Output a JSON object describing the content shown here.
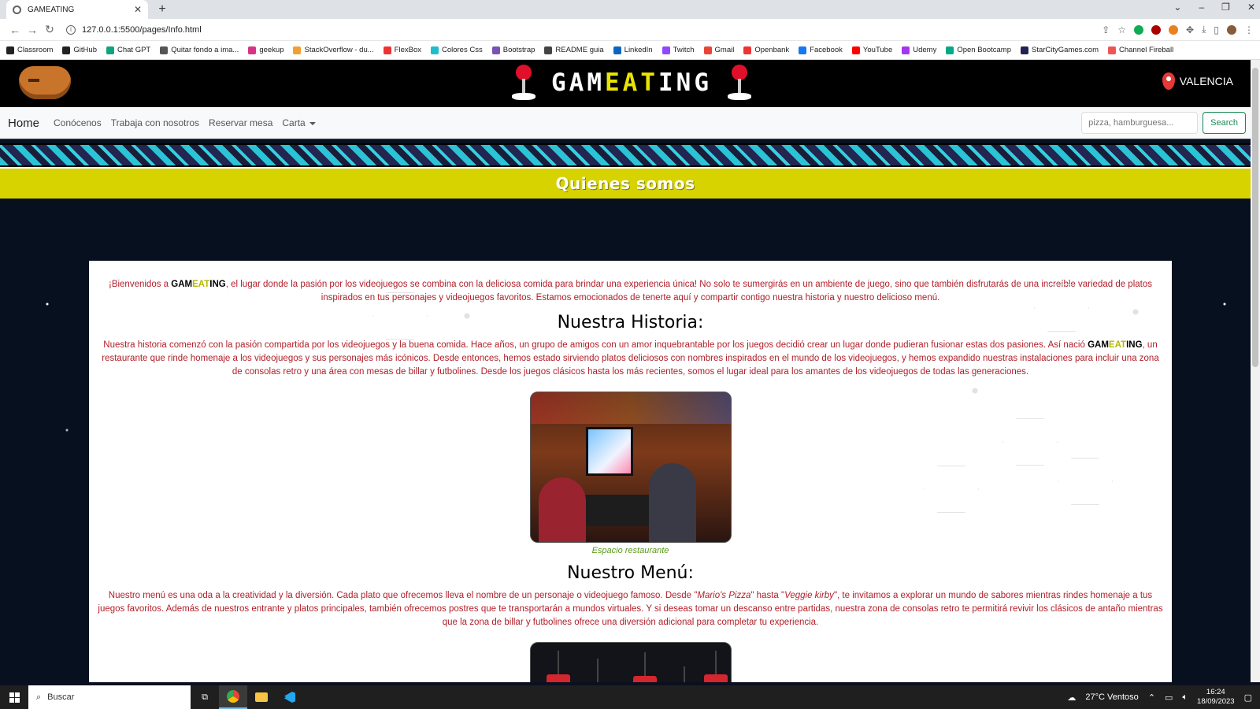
{
  "browser": {
    "tab_title": "GAMEATING",
    "tab_close": "✕",
    "new_tab": "+",
    "url": "127.0.0.1:5500/pages/Info.html",
    "bookmarks": [
      "Classroom",
      "GitHub",
      "Chat GPT",
      "Quitar fondo a ima...",
      "geekup",
      "StackOverflow - du...",
      "FlexBox",
      "Colores Css",
      "Bootstrap",
      "README guia",
      "LinkedIn",
      "Twitch",
      "Gmail",
      "Openbank",
      "Facebook",
      "YouTube",
      "Udemy",
      "Open Bootcamp",
      "StarCityGames.com",
      "Channel Fireball"
    ],
    "bookmark_colors": [
      "#222",
      "#222",
      "#10a37f",
      "#555",
      "#d63384",
      "#f0a030",
      "#e33",
      "#2bc",
      "#7952b3",
      "#444",
      "#0a66c2",
      "#9146ff",
      "#ea4335",
      "#e33",
      "#1877f2",
      "#f00",
      "#a435f0",
      "#0a8",
      "#225",
      "#e55"
    ]
  },
  "header": {
    "brand_left": "GAM",
    "brand_mid": "EAT",
    "brand_right": "ING",
    "location": "VALENCIA"
  },
  "nav": {
    "home": "Home",
    "links": [
      "Conócenos",
      "Trabaja con nosotros",
      "Reservar mesa"
    ],
    "dropdown": "Carta",
    "search_placeholder": "pizza, hamburguesa...",
    "search_button": "Search"
  },
  "section_title": "Quienes somos",
  "intro": {
    "before": "¡Bienvenidos a ",
    "after": ", el lugar donde la pasión por los videojuegos se combina con la deliciosa comida para brindar una experiencia única! No solo te sumergirás en un ambiente de juego, sino que también disfrutarás de una increíble variedad de platos inspirados en tus personajes y videojuegos favoritos. Estamos emocionados de tenerte aquí y compartir contigo nuestra historia y nuestro delicioso menú."
  },
  "historia": {
    "title": "Nuestra Historia:",
    "before": "Nuestra historia comenzó con la pasión compartida por los videojuegos y la buena comida. Hace años, un grupo de amigos con un amor inquebrantable por los juegos decidió crear un lugar donde pudieran fusionar estas dos pasiones. Así nació ",
    "after": ", un restaurante que rinde homenaje a los videojuegos y sus personajes más icónicos. Desde entonces, hemos estado sirviendo platos deliciosos con nombres inspirados en el mundo de los videojuegos, y hemos expandido nuestras instalaciones para incluir una zona de consolas retro y una área con mesas de billar y futbolines. Desde los juegos clásicos hasta los más recientes, somos el lugar ideal para los amantes de los videojuegos de todas las generaciones.",
    "caption": "Espacio restaurante"
  },
  "menu": {
    "title": "Nuestro Menú:",
    "p1": "Nuestro menú es una oda a la creatividad y la diversión. Cada plato que ofrecemos lleva el nombre de un personaje o videojuego famoso. Desde \"",
    "em1": "Mario's Pizza",
    "p2": "\" hasta \"",
    "em2": "Veggie kirby",
    "p3": "\", te invitamos a explorar un mundo de sabores mientras rindes homenaje a tus juegos favoritos. Además de nuestros entrante y platos principales, también ofrecemos postres que te transportarán a mundos virtuales. Y si deseas tomar un descanso entre partidas, nuestra zona de consolas retro te permitirá revivir los clásicos de antaño mientras que la zona de billar y futbolines ofrece una diversión adicional para completar tu experiencia."
  },
  "taskbar": {
    "search": "Buscar",
    "weather": "27°C  Ventoso",
    "time": "16:24",
    "date": "18/09/2023"
  }
}
